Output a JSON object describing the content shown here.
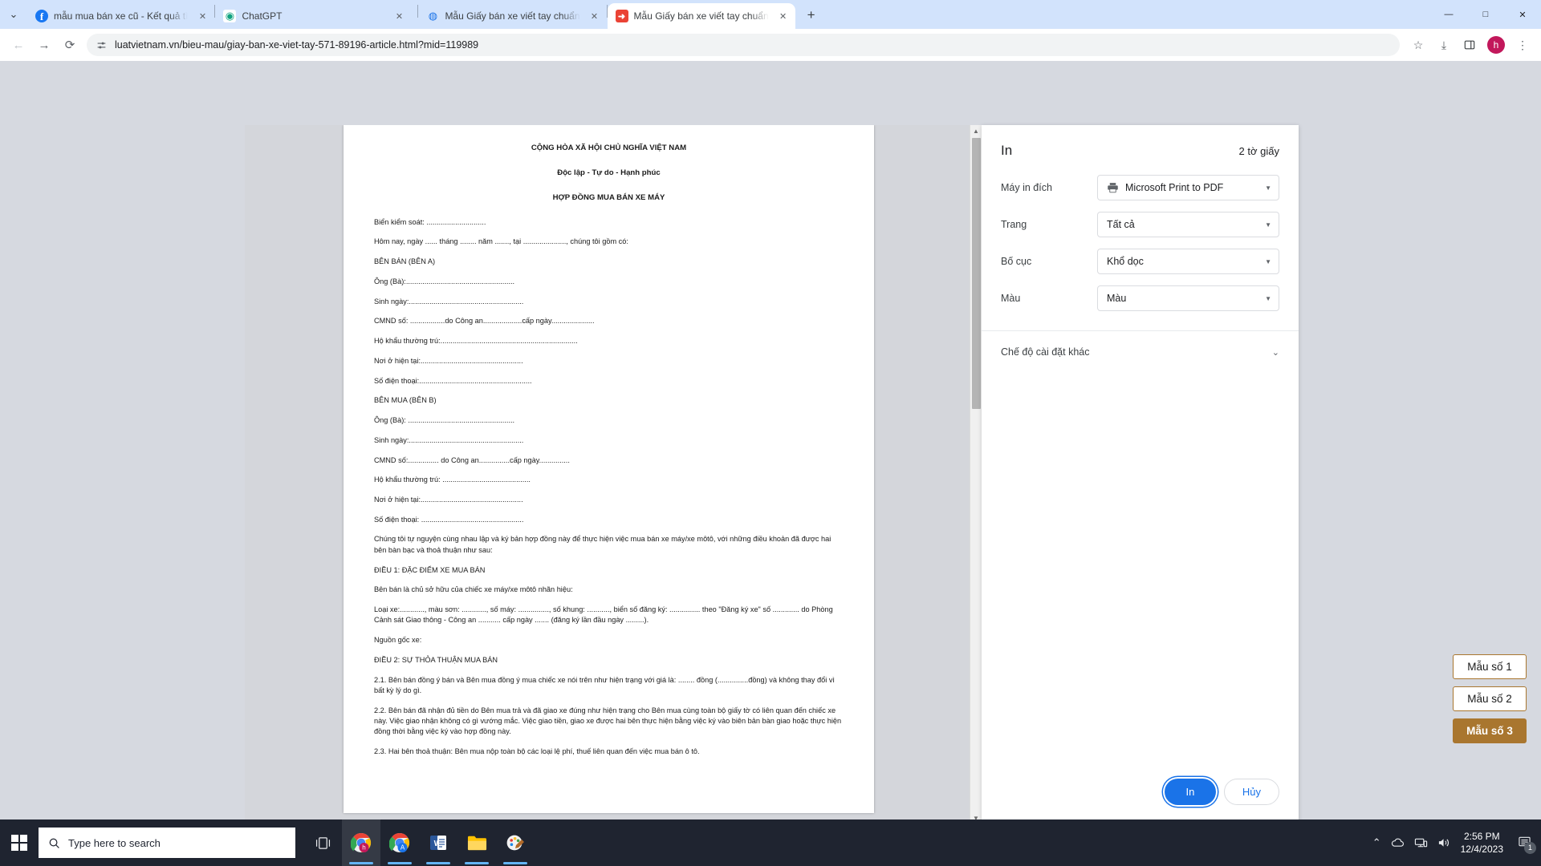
{
  "browser": {
    "tabs": [
      {
        "title": "mẫu mua bán xe cũ - Kết quả tì",
        "favicon": "facebook-icon",
        "active": false
      },
      {
        "title": "ChatGPT",
        "favicon": "chatgpt-icon",
        "active": false
      },
      {
        "title": "Mẫu Giấy bán xe viết tay chuẩn",
        "favicon": "globe-icon",
        "active": false
      },
      {
        "title": "Mẫu Giấy bán xe viết tay chuẩn",
        "favicon": "pdf-icon",
        "active": true
      }
    ],
    "new_tab_label": "+",
    "tab_close_label": "✕",
    "tablist_chevron": "⌄",
    "window_controls": {
      "minimize": "—",
      "maximize": "□",
      "close": "✕"
    },
    "nav": {
      "back": "←",
      "forward": "→",
      "reload": "⟳"
    },
    "omnibox": {
      "site_info_icon": "tune-icon",
      "url": "luatvietnam.vn/bieu-mau/giay-ban-xe-viet-tay-571-89196-article.html?mid=119989"
    },
    "toolbar_right": {
      "bookmark": "☆",
      "download": "⤓",
      "side_panel": "▯",
      "profile_initial": "h",
      "menu": "⋮"
    }
  },
  "print_dialog": {
    "title": "In",
    "sheets": "2 tờ giấy",
    "rows": [
      {
        "label": "Máy in đích",
        "value": "Microsoft Print to PDF",
        "icon": "printer-icon"
      },
      {
        "label": "Trang",
        "value": "Tất cả",
        "icon": ""
      },
      {
        "label": "Bố cục",
        "value": "Khổ dọc",
        "icon": ""
      },
      {
        "label": "Màu",
        "value": "Màu",
        "icon": ""
      }
    ],
    "more_settings": "Chế độ cài đặt khác",
    "more_settings_chevron": "⌄",
    "print_button": "In",
    "cancel_button": "Hủy",
    "accent_color": "#1a73e8"
  },
  "preview_document": {
    "header1": "CỘNG HÒA XÃ HỘI CHỦ NGHĨA VIỆT NAM",
    "header2": "Độc lập - Tự do - Hạnh phúc",
    "header3": "HỢP ĐỒNG MUA BÁN XE MÁY",
    "lines": [
      "Biển kiểm soát: .............................",
      "Hôm nay, ngày ...... tháng ........ năm ......., tại ....................., chúng tôi gồm có:",
      "BÊN BÁN (BÊN A)",
      "Ông (Bà):.....................................................",
      "Sinh ngày:........................................................",
      "CMND số: .................do Công an...................cấp ngày.....................",
      "Hộ khẩu thường trú:...................................................................",
      "Nơi ở hiện tại:..................................................",
      "Số điện thoại:.......................................................",
      "BÊN MUA (BÊN B)",
      "Ông (Bà): ....................................................",
      "Sinh ngày:........................................................",
      "CMND số:............... do Công an...............cấp ngày...............",
      "Hộ khẩu thường trú: ...........................................",
      "Nơi ở hiện tại:..................................................",
      "Số điện thoại: ..................................................",
      "Chúng tôi tự nguyện cùng nhau lập và ký bản hợp đồng này để thực hiện việc mua bán xe máy/xe môtô, với những điều khoản đã được hai bên bàn bạc và thoả thuận như sau:",
      "ĐIỀU 1: ĐẶC ĐIỂM XE MUA BÁN",
      "Bên bán là chủ sở hữu của chiếc xe máy/xe môtô nhãn hiệu:",
      "Loại xe:............, màu sơn: ............, số máy: ..............., số khung: ..........., biển số đăng ký: ............... theo \"Đăng ký xe\" số ............. do Phòng Cảnh sát Giao thông - Công an ........... cấp ngày ....... (đăng ký lần đầu ngày .........).",
      "Nguồn gốc xe:",
      "ĐIỀU 2: SỰ THỎA THUẬN MUA BÁN",
      "2.1. Bên bán đồng ý bán và Bên mua đồng ý mua chiếc xe nói trên như hiện trạng với giá là: ........ đồng (...............đồng) và không thay đổi vì bất kỳ lý do gì.",
      "2.2. Bên bán đã nhận đủ tiền do Bên mua trả và đã giao xe đúng như hiện trạng cho Bên mua cùng toàn bộ giấy tờ có liên quan đến chiếc xe này. Việc giao nhận không có gì vướng mắc. Việc giao tiền, giao xe được hai bên thực hiện bằng việc ký vào biên bản bàn giao hoặc thực hiện đồng thời bằng việc ký vào hợp đồng này.",
      "2.3. Hai bên thoả thuận: Bên mua nộp toàn bộ các loại lệ phí, thuế liên quan đến việc mua bán ô tô."
    ]
  },
  "background_page": {
    "clipped_line": "Loại xe:............, màu sơn: ............, số máy: ..............., số khung: ..........., biển số đăng ký: ............... theo \"Đăng ký xe\" số ............. do Phòng Cảnh",
    "line2": "sát Giao thông - Công an ........... cấp ngày ....... (đăng ký lần đầu ngày .........).",
    "line3": "Nguồn gốc xe:",
    "scroll_up": "▲",
    "scroll_down": "▼"
  },
  "template_buttons": {
    "accent_color": "#a9762f",
    "items": [
      {
        "label": "Mẫu số 1",
        "active": false
      },
      {
        "label": "Mẫu số 2",
        "active": false
      },
      {
        "label": "Mẫu số 3",
        "active": true
      }
    ]
  },
  "taskbar": {
    "search_placeholder": "Type here to search",
    "apps": [
      {
        "name": "task-view",
        "glyph": "⧉"
      },
      {
        "name": "chrome-profile-h",
        "glyph": ""
      },
      {
        "name": "chrome-profile-a",
        "glyph": ""
      },
      {
        "name": "word",
        "glyph": "W"
      },
      {
        "name": "file-explorer",
        "glyph": ""
      },
      {
        "name": "paint",
        "glyph": ""
      }
    ],
    "tray": {
      "show_hidden": "⌃",
      "onedrive": "☁",
      "network": "🖧",
      "volume": "🔊",
      "time": "2:56 PM",
      "date": "12/4/2023",
      "notification_count": "1"
    }
  }
}
